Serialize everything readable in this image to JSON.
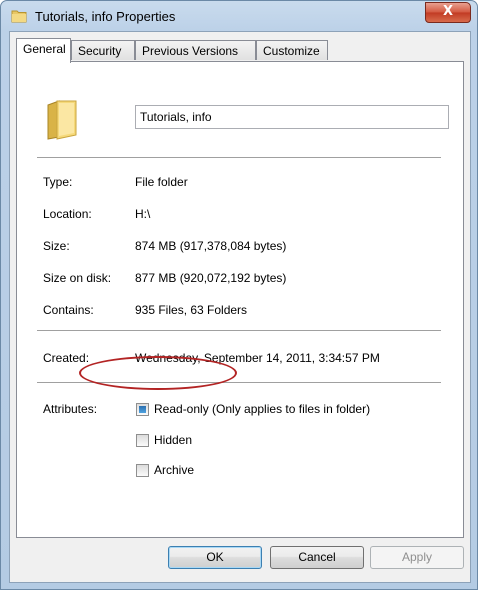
{
  "window": {
    "title": "Tutorials, info Properties",
    "close_label": "X"
  },
  "tabs": [
    {
      "label": "General",
      "active": true
    },
    {
      "label": "Security",
      "active": false
    },
    {
      "label": "Previous Versions",
      "active": false
    },
    {
      "label": "Customize",
      "active": false
    }
  ],
  "general": {
    "name": "Tutorials, info",
    "fields": [
      {
        "label": "Type:",
        "value": "File folder"
      },
      {
        "label": "Location:",
        "value": "H:\\"
      },
      {
        "label": "Size:",
        "value": "874 MB (917,378,084 bytes)"
      },
      {
        "label": "Size on disk:",
        "value": "877 MB (920,072,192 bytes)"
      },
      {
        "label": "Contains:",
        "value": "935 Files, 63 Folders"
      },
      {
        "label": "Created:",
        "value": "Wednesday, September 14, 2011, 3:34:57 PM"
      }
    ],
    "attributes_label": "Attributes:",
    "attributes": [
      {
        "label": "Read-only (Only applies to files in folder)",
        "state": "indeterminate",
        "highlighted": true
      },
      {
        "label": "Hidden",
        "state": "unchecked"
      },
      {
        "label": "Archive",
        "state": "unchecked"
      }
    ]
  },
  "buttons": {
    "ok": "OK",
    "cancel": "Cancel",
    "apply": "Apply"
  },
  "colors": {
    "highlight_ellipse": "#b32424",
    "check_fill": "#2b6fb0"
  },
  "icons": {
    "title": "folder-icon",
    "large": "folder-icon"
  }
}
